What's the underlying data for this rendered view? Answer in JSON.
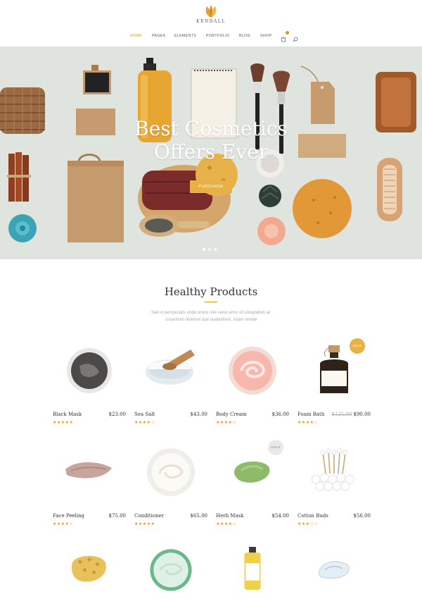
{
  "brand": {
    "name": "KENDALL",
    "accent": "#d99a2b"
  },
  "nav": {
    "items": [
      "HOME",
      "PAGES",
      "ELEMENTS",
      "PORTFOLIO",
      "BLOG",
      "SHOP"
    ],
    "active": "HOME",
    "icons": [
      "cart-icon",
      "search-icon"
    ]
  },
  "hero": {
    "title_line1": "Best Cosmetics",
    "title_line2": "Offers Ever",
    "button": "PURCHASE",
    "slides": 3,
    "active_slide": 1
  },
  "section": {
    "title": "Healthy Products",
    "subtitle_line1": "Sed ut perspiciatis unde omnis iste natus error sit voluptatem ac",
    "subtitle_line2": "cusantium dolorem que laudantium, totam remde"
  },
  "products": [
    {
      "name": "Black Mask",
      "price": "$23.00",
      "old_price": "",
      "rating": 5,
      "badge": ""
    },
    {
      "name": "Sea Salt",
      "price": "$43.00",
      "old_price": "",
      "rating": 4,
      "badge": ""
    },
    {
      "name": "Body Cream",
      "price": "$36.00",
      "old_price": "",
      "rating": 4,
      "badge": ""
    },
    {
      "name": "Foam Bath",
      "price": "$90.00",
      "old_price": "$125.00",
      "rating": 4,
      "badge": "SALE"
    },
    {
      "name": "Face Peeling",
      "price": "$75.00",
      "old_price": "",
      "rating": 4,
      "badge": ""
    },
    {
      "name": "Conditioner",
      "price": "$65.00",
      "old_price": "",
      "rating": 5,
      "badge": ""
    },
    {
      "name": "Herb Mask",
      "price": "$54.00",
      "old_price": "",
      "rating": 4,
      "badge": "SOLD"
    },
    {
      "name": "Cotton Buds",
      "price": "$56.00",
      "old_price": "",
      "rating": 3,
      "badge": ""
    }
  ]
}
